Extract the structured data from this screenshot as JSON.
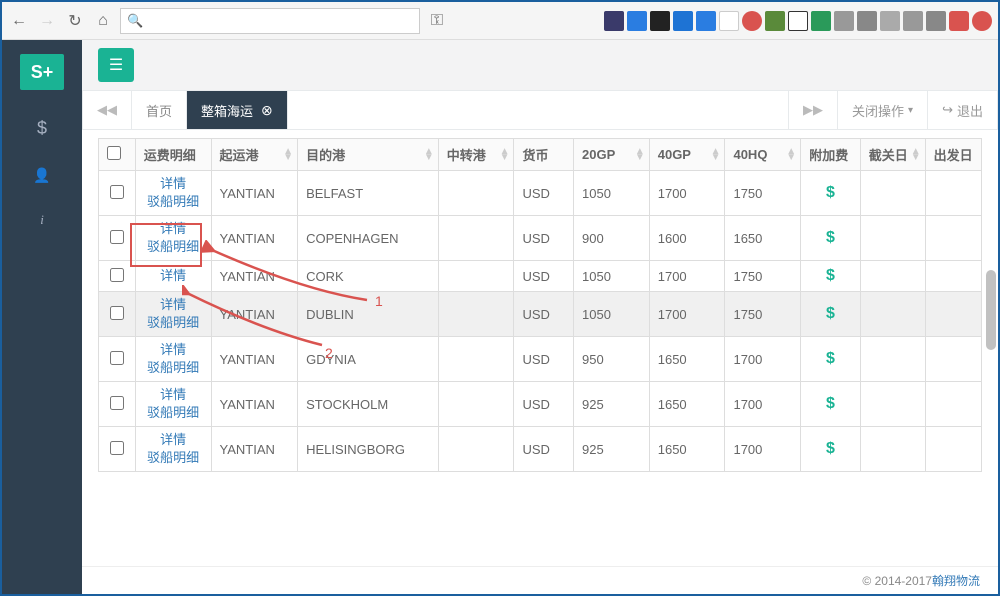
{
  "browser": {
    "key_icon": "⚿"
  },
  "sidebar": {
    "logo": "S+",
    "items": [
      {
        "icon": "$"
      },
      {
        "icon": "👤"
      },
      {
        "icon": "i"
      }
    ]
  },
  "tabs": {
    "home": "首页",
    "active": "整箱海运",
    "close_label": "关闭操作",
    "exit": "退出"
  },
  "table": {
    "headers": {
      "detail": "运费明细",
      "origin": "起运港",
      "destination": "目的港",
      "transit": "中转港",
      "currency": "货币",
      "gp20": "20GP",
      "gp40": "40GP",
      "hq40": "40HQ",
      "surcharge": "附加费",
      "cutoff": "截关日",
      "depart": "出发日"
    },
    "detail_link": "详情",
    "barge_link": "驳船明细",
    "rows": [
      {
        "origin": "YANTIAN",
        "destination": "BELFAST",
        "transit": "",
        "currency": "USD",
        "gp20": "1050",
        "gp40": "1700",
        "hq40": "1750",
        "barge": true,
        "sel": false
      },
      {
        "origin": "YANTIAN",
        "destination": "COPENHAGEN",
        "transit": "",
        "currency": "USD",
        "gp20": "900",
        "gp40": "1600",
        "hq40": "1650",
        "barge": true,
        "sel": false,
        "highlight": true
      },
      {
        "origin": "YANTIAN",
        "destination": "CORK",
        "transit": "",
        "currency": "USD",
        "gp20": "1050",
        "gp40": "1700",
        "hq40": "1750",
        "barge": false,
        "sel": false
      },
      {
        "origin": "YANTIAN",
        "destination": "DUBLIN",
        "transit": "",
        "currency": "USD",
        "gp20": "1050",
        "gp40": "1700",
        "hq40": "1750",
        "barge": true,
        "sel": true
      },
      {
        "origin": "YANTIAN",
        "destination": "GDYNIA",
        "transit": "",
        "currency": "USD",
        "gp20": "950",
        "gp40": "1650",
        "hq40": "1700",
        "barge": true,
        "sel": false
      },
      {
        "origin": "YANTIAN",
        "destination": "STOCKHOLM",
        "transit": "",
        "currency": "USD",
        "gp20": "925",
        "gp40": "1650",
        "hq40": "1700",
        "barge": true,
        "sel": false
      },
      {
        "origin": "YANTIAN",
        "destination": "HELISINGBORG",
        "transit": "",
        "currency": "USD",
        "gp20": "925",
        "gp40": "1650",
        "hq40": "1700",
        "barge": true,
        "sel": false
      }
    ]
  },
  "annotations": {
    "label1": "1",
    "label2": "2"
  },
  "footer": {
    "copyright": "© 2014-2017 ",
    "company": "翰翔物流"
  }
}
